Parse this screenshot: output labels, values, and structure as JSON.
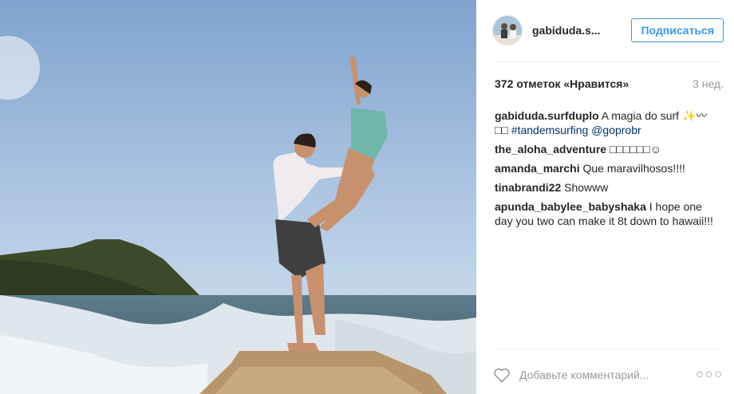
{
  "post": {
    "username": "gabiduda.s...",
    "follow_label": "Подписаться",
    "likes": "372 отметок «Нравится»",
    "time": "3 нед."
  },
  "caption": {
    "user": "gabiduda.surfduplo",
    "text": " A magia do surf ✨〰",
    "line2_prefix": "□□ ",
    "hashtag": "#tandemsurfing",
    "mention": " @goprobr"
  },
  "comments": [
    {
      "user": "the_aloha_adventure",
      "text": " □□□□□□☺"
    },
    {
      "user": "amanda_marchi",
      "text": " Que maravilhosos!!!!"
    },
    {
      "user": "tinabrandi22",
      "text": " Showww"
    },
    {
      "user": "apunda_babylee_babyshaka",
      "text": " I hope one day you two can make it 8t down to hawaii!!!"
    }
  ],
  "footer": {
    "add_comment_placeholder": "Добавьте комментарий...",
    "more_label": "○○○"
  },
  "colors": {
    "accent": "#3897f0",
    "link": "#003569",
    "muted": "#999999"
  }
}
